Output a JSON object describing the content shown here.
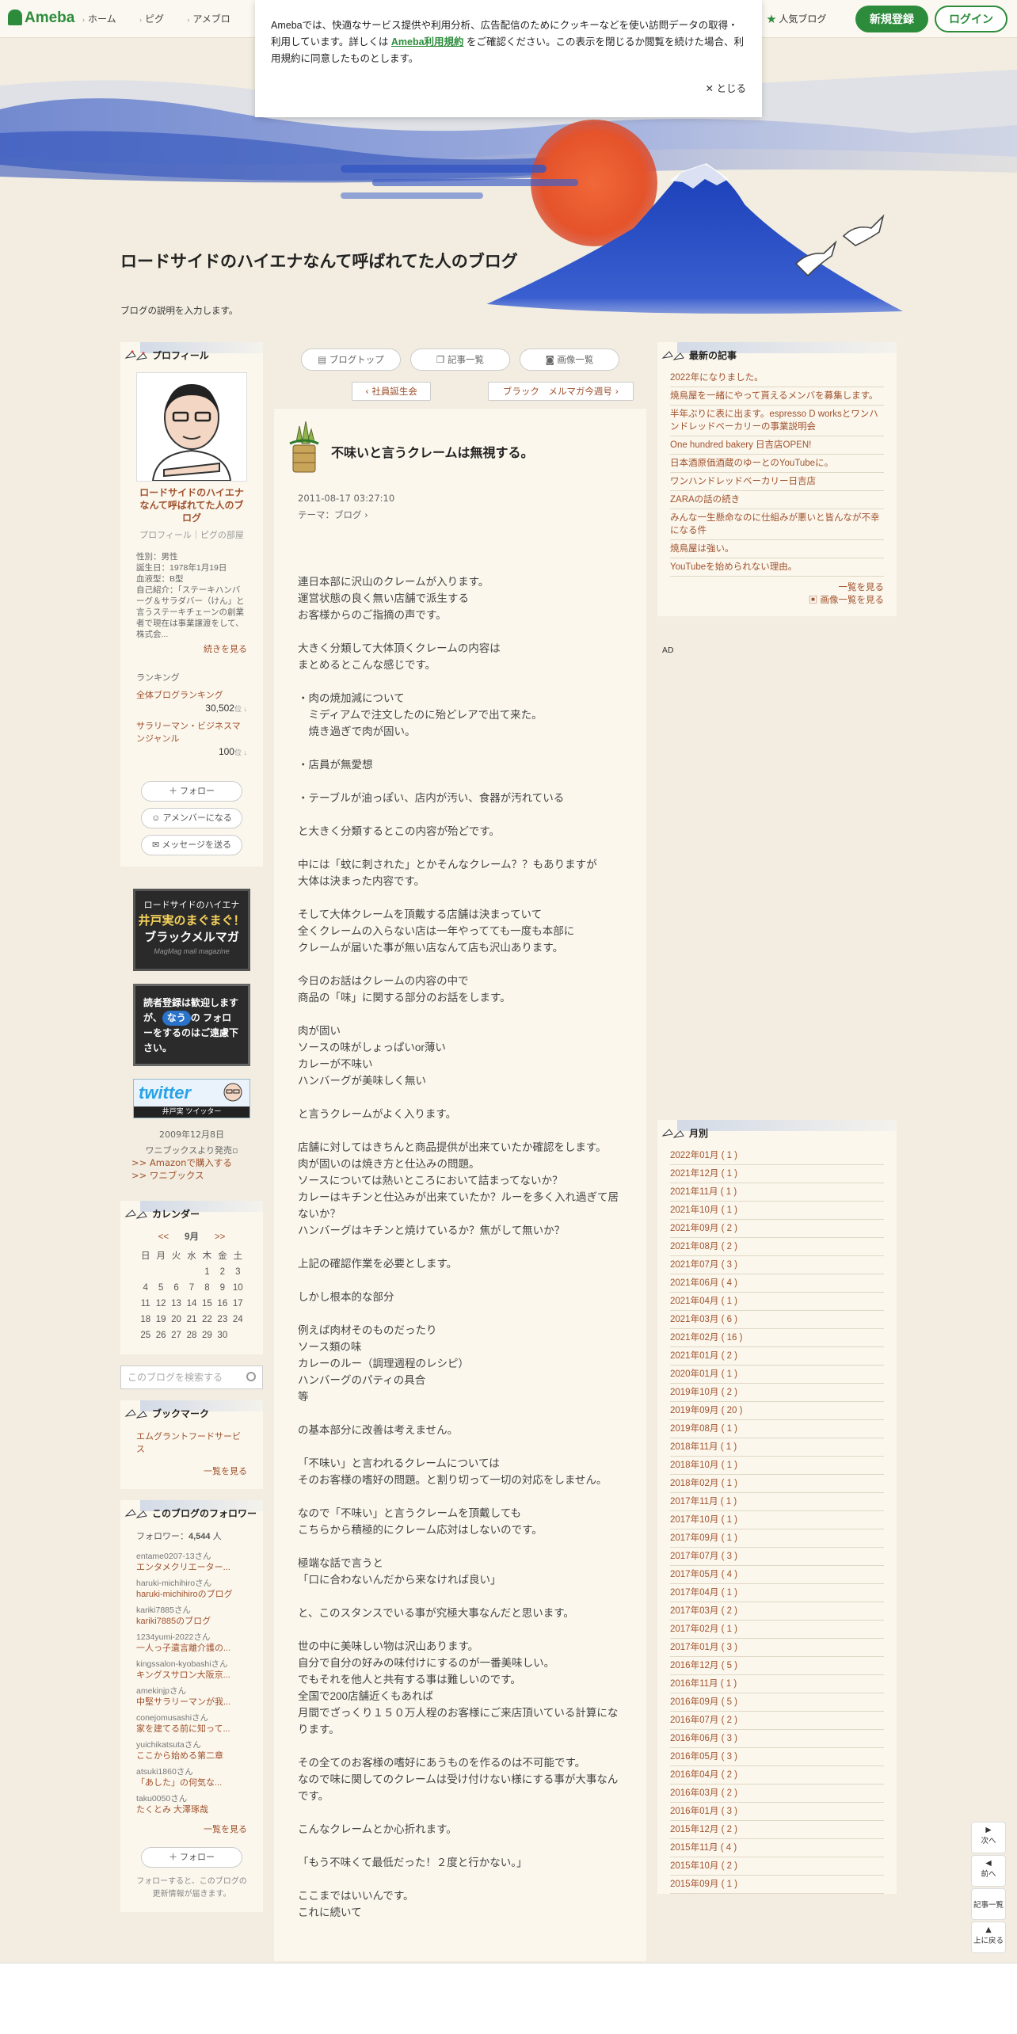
{
  "header": {
    "logo": "Ameba",
    "nav": [
      "ホーム",
      "ピグ",
      "アメブロ"
    ],
    "popular": "人気ブログ",
    "register": "新規登録",
    "login": "ログイン"
  },
  "cookie": {
    "text_pre": "Amebaでは、快適なサービス提供や利用分析、広告配信のためにクッキーなどを使い訪問データの取得・利用しています。詳しくは ",
    "link": "Ameba利用規約",
    "text_post": " をご確認ください。この表示を閉じるか閲覧を続けた場合、利用規約に同意したものとします。",
    "close": "とじる"
  },
  "blog": {
    "title": "ロードサイドのハイエナなんて呼ばれてた人のブログ",
    "description": "ブログの説明を入力します。"
  },
  "profile": {
    "heading": "プロフィール",
    "name": "ロードサイドのハイエナなんて呼ばれてた人のブログ",
    "links": "プロフィール｜ピグの部屋",
    "info": "性別：男性\n誕生日：1978年1月19日\n血液型：B型\n自己紹介：「ステーキハンバーグ＆サラダバー（けん」と言うステーキチェーンの創業者で現在は事業譲渡をして、株式会...",
    "more": "続きを見る",
    "ranking_label": "ランキング",
    "rank1_label": "全体ブログランキング",
    "rank1_value": "30,502",
    "rank1_unit": "位 ↓",
    "rank2_label": "サラリーマン・ビジネスマンジャンル",
    "rank2_value": "100",
    "rank2_unit": "位 ↓",
    "follow": "フォロー",
    "member": "アメンバーになる",
    "message": "メッセージを送る"
  },
  "banners": {
    "b1_line1": "ロードサイドのハイエナ",
    "b1_line2": "井戸実のまぐまぐ！",
    "b1_line3": "ブラックメルマガ",
    "b1_line4": "MagMag mail magazine",
    "b2_text1": "読者登録は歓迎しますが、",
    "b2_badge": "なう",
    "b2_text2": "の フォローをするのはご遠慮下さい。",
    "b3_logo": "twitter",
    "b3_sub": "井戸実 ツイッター",
    "book_date": "2009年12月8日",
    "book_pub": "ワニブックスより発売",
    "amazon": ">> Amazonで購入する",
    "wani": ">> ワニブックス"
  },
  "calendar": {
    "heading": "カレンダー",
    "prev": "<<",
    "month": "9月",
    "next": ">>",
    "weekdays": [
      "日",
      "月",
      "火",
      "水",
      "木",
      "金",
      "土"
    ],
    "rows": [
      [
        "",
        "",
        "",
        "",
        "1",
        "2",
        "3"
      ],
      [
        "4",
        "5",
        "6",
        "7",
        "8",
        "9",
        "10"
      ],
      [
        "11",
        "12",
        "13",
        "14",
        "15",
        "16",
        "17"
      ],
      [
        "18",
        "19",
        "20",
        "21",
        "22",
        "23",
        "24"
      ],
      [
        "25",
        "26",
        "27",
        "28",
        "29",
        "30",
        ""
      ]
    ]
  },
  "search": {
    "placeholder": "このブログを検索する"
  },
  "bookmark": {
    "heading": "ブックマーク",
    "item": "エムグラントフードサービス",
    "more": "一覧を見る"
  },
  "followers": {
    "heading": "このブログのフォロワー",
    "count_label": "フォロワー：",
    "count": "4,544",
    "count_unit": "人",
    "items": [
      {
        "user": "entame0207-13さん",
        "blog": "エンタメクリエーター..."
      },
      {
        "user": "haruki-michihiroさん",
        "blog": "haruki-michihiroのブログ"
      },
      {
        "user": "kariki7885さん",
        "blog": "kariki7885のブログ"
      },
      {
        "user": "1234yumi-2022さん",
        "blog": "一人っ子遺言離介護の..."
      },
      {
        "user": "kingssalon-kyobashiさん",
        "blog": "キングスサロン大阪京..."
      },
      {
        "user": "amekinjpさん",
        "blog": "中堅サラリーマンが我..."
      },
      {
        "user": "conejomusashiさん",
        "blog": "家を建てる前に知って..."
      },
      {
        "user": "yuichikatsutaさん",
        "blog": "ここから始める第二章"
      },
      {
        "user": "atsuki1860さん",
        "blog": "「あした」の何気な..."
      },
      {
        "user": "taku0050さん",
        "blog": "たくとみ 大澤琢哉"
      }
    ],
    "more": "一覧を見る",
    "follow": "フォロー",
    "note": "フォローすると、このブログの更新情報が届きます。"
  },
  "main": {
    "tab_top": "ブログトップ",
    "tab_list": "記事一覧",
    "tab_images": "画像一覧",
    "prev": "社員誕生会",
    "next": "ブラック　メルマガ今週号",
    "title": "不味いと言うクレームは無視する。",
    "date": "2011-08-17 03:27:10",
    "theme_label": "テーマ：",
    "theme": "ブログ",
    "body": "連日本部に沢山のクレームが入ります。\n運営状態の良く無い店舗で派生する\nお客様からのご指摘の声です。\n\n大きく分類して大体頂くクレームの内容は\nまとめるとこんな感じです。\n\n・肉の焼加減について\n　ミディアムで注文したのに殆どレアで出て来た。\n　焼き過ぎで肉が固い。\n\n・店員が無愛想\n\n・テーブルが油っぽい、店内が汚い、食器が汚れている\n\nと大きく分類するとこの内容が殆どです。\n\n中には「蚊に刺された」とかそんなクレーム？？もありますが\n大体は決まった内容です。\n\nそして大体クレームを頂戴する店舗は決まっていて\n全くクレームの入らない店は一年やってても一度も本部に\nクレームが届いた事が無い店なんて店も沢山あります。\n\n今日のお話はクレームの内容の中で\n商品の「味」に関する部分のお話をします。\n\n肉が固い\nソースの味がしょっぱいor薄い\nカレーが不味い\nハンバーグが美味しく無い\n\nと言うクレームがよく入ります。\n\n店舗に対してはきちんと商品提供が出来ていたか確認をします。\n肉が固いのは焼き方と仕込みの問題。\nソースについては熱いところにおいて詰まってないか？\nカレーはキチンと仕込みが出来ていたか？ルーを多く入れ過ぎて居ないか？\nハンバーグはキチンと焼けているか？焦がして無いか？\n\n上記の確認作業を必要とします。\n\nしかし根本的な部分\n\n例えば肉材そのものだったり\nソース類の味\nカレーのルー（調理週程のレシピ）\nハンバーグのパティの具合\n等\n\nの基本部分に改善は考えません。\n\n「不味い」と言われるクレームについては\nそのお客様の嗜好の問題。と割り切って一切の対応をしません。\n\nなので「不味い」と言うクレームを頂戴しても\nこちらから積極的にクレーム応対はしないのです。\n\n極端な話で言うと\n「口に合わないんだから来なければ良い」\n\nと、このスタンスでいる事が究極大事なんだと思います。\n\n世の中に美味しい物は沢山あります。\n自分で自分の好みの味付けにするのが一番美味しい。\nでもそれを他人と共有する事は難しいのです。\n全国で200店舗近くもあれば\n月間でざっくり１５０万人程のお客様にご来店頂いている計算になります。\n\nその全てのお客様の嗜好にあうものを作るのは不可能です。\nなので味に関してのクレームは受け付けない様にする事が大事なんです。\n\nこんなクレームとか心折れます。\n\n「もう不味くて最低だった！２度と行かない。」\n\nここまではいいんです。\nこれに続いて"
  },
  "recent": {
    "heading": "最新の記事",
    "items": [
      "2022年になりました。",
      "焼鳥屋を一緒にやって貰えるメンバを募集します。",
      "半年ぶりに表に出ます。espresso D worksとワンハンドレッドベーカリーの事業説明会",
      "One hundred bakery 日吉店OPEN!",
      "日本酒原価酒蔵のゆーとのYouTubeに。",
      "ワンハンドレッドベーカリー日吉店",
      "ZARAの話の続き",
      "みんな一生懸命なのに仕組みが悪いと皆んなが不幸になる件",
      "焼鳥屋は強い。",
      "YouTubeを始められない理由。"
    ],
    "more": "一覧を見る",
    "images": "画像一覧を見る"
  },
  "ad": "AD",
  "monthly": {
    "heading": "月別",
    "items": [
      "2022年01月 ( 1 )",
      "2021年12月 ( 1 )",
      "2021年11月 ( 1 )",
      "2021年10月 ( 1 )",
      "2021年09月 ( 2 )",
      "2021年08月 ( 2 )",
      "2021年07月 ( 3 )",
      "2021年06月 ( 4 )",
      "2021年04月 ( 1 )",
      "2021年03月 ( 6 )",
      "2021年02月 ( 16 )",
      "2021年01月 ( 2 )",
      "2020年01月 ( 1 )",
      "2019年10月 ( 2 )",
      "2019年09月 ( 20 )",
      "2019年08月 ( 1 )",
      "2018年11月 ( 1 )",
      "2018年10月 ( 1 )",
      "2018年02月 ( 1 )",
      "2017年11月 ( 1 )",
      "2017年10月 ( 1 )",
      "2017年09月 ( 1 )",
      "2017年07月 ( 3 )",
      "2017年05月 ( 4 )",
      "2017年04月 ( 1 )",
      "2017年03月 ( 2 )",
      "2017年02月 ( 1 )",
      "2017年01月 ( 3 )",
      "2016年12月 ( 5 )",
      "2016年11月 ( 1 )",
      "2016年09月 ( 5 )",
      "2016年07月 ( 2 )",
      "2016年06月 ( 3 )",
      "2016年05月 ( 3 )",
      "2016年04月 ( 2 )",
      "2016年03月 ( 2 )",
      "2016年01月 ( 3 )",
      "2015年12月 ( 2 )",
      "2015年11月 ( 4 )",
      "2015年10月 ( 2 )",
      "2015年09月 ( 1 )"
    ]
  },
  "float": {
    "next": "次へ",
    "prev": "前へ",
    "list": "記事一覧",
    "top": "上に戻る"
  },
  "colors": {
    "accent": "#2d8c3c",
    "link": "#a0522d",
    "paper": "#f2ede0"
  }
}
